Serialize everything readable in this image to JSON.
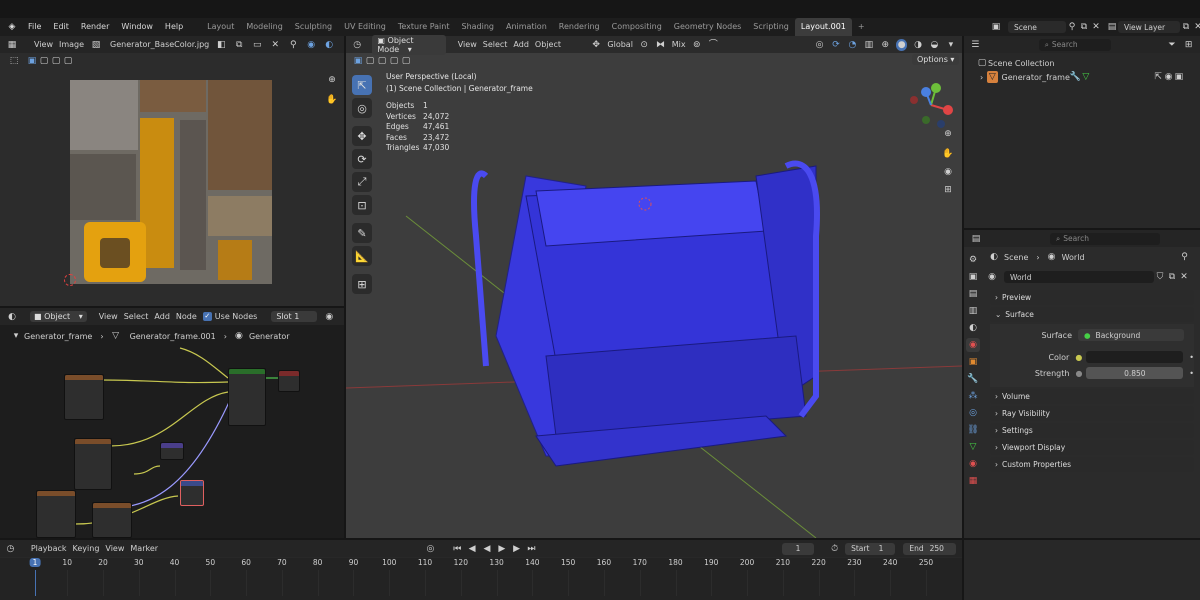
{
  "menu": [
    "File",
    "Edit",
    "Render",
    "Window",
    "Help"
  ],
  "workspaces": [
    "Layout",
    "Modeling",
    "Sculpting",
    "UV Editing",
    "Texture Paint",
    "Shading",
    "Animation",
    "Rendering",
    "Compositing",
    "Geometry Nodes",
    "Scripting",
    "Layout.001"
  ],
  "active_workspace": "Layout.001",
  "scene": {
    "name": "Scene",
    "view_layer": "View Layer"
  },
  "image_editor": {
    "view": "View",
    "image": "Image",
    "image_name": "Generator_BaseColor.jpg"
  },
  "node_editor": {
    "mode": "Object",
    "view": "View",
    "select": "Select",
    "add": "Add",
    "node": "Node",
    "use_nodes": "Use Nodes",
    "slot": "Slot 1",
    "breadcrumb": [
      "Generator_frame",
      "Generator_frame.001",
      "Generator"
    ]
  },
  "viewport": {
    "mode": "Object Mode",
    "view": "View",
    "select": "Select",
    "add": "Add",
    "object": "Object",
    "orientation": "Global",
    "pivot": "Mix",
    "options": "Options",
    "perspective": "User Perspective (Local)",
    "collection": "(1) Scene Collection | Generator_frame",
    "stats": [
      {
        "k": "Objects",
        "v": "1"
      },
      {
        "k": "Vertices",
        "v": "24,072"
      },
      {
        "k": "Edges",
        "v": "47,461"
      },
      {
        "k": "Faces",
        "v": "23,472"
      },
      {
        "k": "Triangles",
        "v": "47,030"
      }
    ]
  },
  "outliner": {
    "search_placeholder": "Search",
    "root": "Scene Collection",
    "item": "Generator_frame"
  },
  "properties": {
    "search_placeholder": "Search",
    "breadcrumb_scene": "Scene",
    "breadcrumb_world": "World",
    "world_name": "World",
    "sections": {
      "preview": "Preview",
      "surface": "Surface",
      "volume": "Volume",
      "ray_visibility": "Ray Visibility",
      "settings": "Settings",
      "viewport_display": "Viewport Display",
      "custom_properties": "Custom Properties"
    },
    "surface_label": "Surface",
    "surface_value": "Background",
    "color_label": "Color",
    "strength_label": "Strength",
    "strength_value": "0.850"
  },
  "timeline": {
    "playback": "Playback",
    "keying": "Keying",
    "view": "View",
    "marker": "Marker",
    "current_frame": "1",
    "start_label": "Start",
    "start": "1",
    "end_label": "End",
    "end": "250",
    "ticks": [
      "1",
      "10",
      "20",
      "30",
      "40",
      "50",
      "60",
      "70",
      "80",
      "90",
      "100",
      "110",
      "120",
      "130",
      "140",
      "150",
      "160",
      "170",
      "180",
      "190",
      "200",
      "210",
      "220",
      "230",
      "240",
      "250"
    ]
  },
  "colors": {
    "accent": "#4772b3",
    "mesh": "#3a3ae0",
    "header": "#252525",
    "panel": "#303030"
  }
}
